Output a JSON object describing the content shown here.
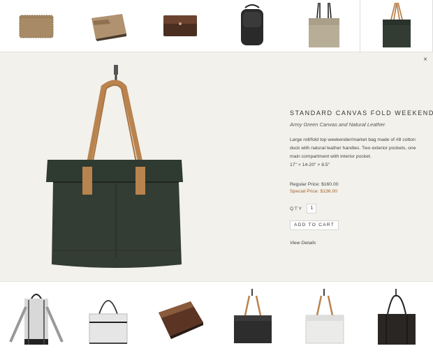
{
  "top_thumbnails": [
    {
      "icon": "tan-bifold-wallet-icon"
    },
    {
      "icon": "tan-card-wallet-icon"
    },
    {
      "icon": "brown-leather-clutch-icon"
    },
    {
      "icon": "black-leather-pouch-icon"
    },
    {
      "icon": "khaki-tote-icon"
    },
    {
      "icon": "green-fold-weekender-icon",
      "selected": true
    }
  ],
  "product": {
    "title": "STANDARD CANVAS FOLD WEEKENDER",
    "subtitle": "Army Green Canvas and Natural Leather",
    "description": "Large roll/fold top weekender/market bag made of #8 cotton duck with natural leather handles. Two exterior pockets, one main compartment with interior pocket.",
    "dimensions": "17\" × 14-20\" × 8.5\"",
    "regular_price": "Regular Price: $160.00",
    "special_price": "Special Price: $136.00",
    "qty_label": "QTY",
    "qty_value": "1",
    "add_to_cart": "ADD TO CART",
    "view_details": "View Details",
    "close_glyph": "×"
  },
  "bottom_thumbnails": [
    {
      "icon": "grey-backpack-icon"
    },
    {
      "icon": "white-canvas-tote-icon"
    },
    {
      "icon": "brown-leather-sleeve-icon"
    },
    {
      "icon": "black-tote-icon"
    },
    {
      "icon": "white-tote-icon"
    },
    {
      "icon": "black-leather-tote-icon"
    }
  ],
  "colors": {
    "detail_background": "#f2f1ec",
    "special_price": "#a2642b",
    "bag_green": "#333d33",
    "leather_tan": "#b9834f"
  }
}
